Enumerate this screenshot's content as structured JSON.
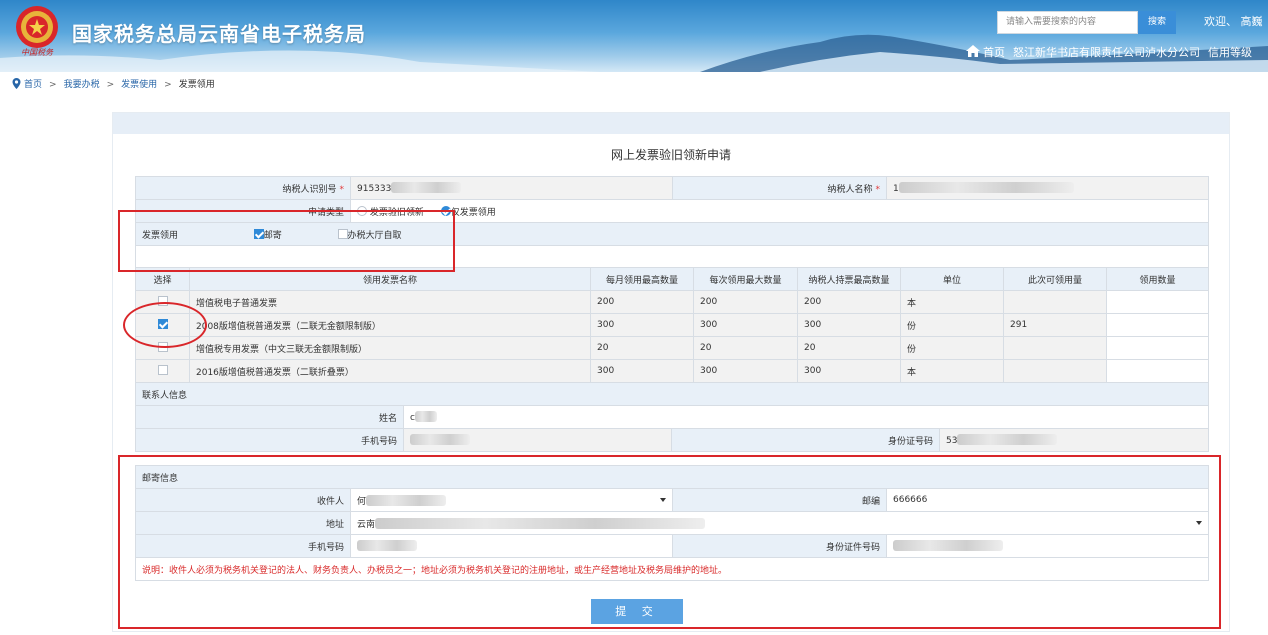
{
  "header": {
    "site_title": "国家税务总局云南省电子税务局",
    "emblem_sub": "中国税务",
    "search_placeholder": "请输入需要搜索的内容",
    "search_button": "搜索",
    "welcome": "欢迎、 高巍",
    "nav_home": "首页",
    "org_name": "怒江新华书店有限责任公司泸水分公司",
    "credit_label": "信用等级"
  },
  "breadcrumb": [
    "首页",
    "我要办税",
    "发票使用",
    "发票领用"
  ],
  "form": {
    "title": "网上发票验旧领新申请",
    "taxpayer_id_label": "纳税人识别号",
    "taxpayer_id_value": "915333",
    "taxpayer_name_label": "纳税人名称",
    "taxpayer_name_value": "1",
    "apply_type_label": "申请类型",
    "apply_type_options": [
      "发票验旧领新",
      "仅发票领用"
    ],
    "receive_label": "发票领用",
    "receive_options": [
      "邮寄",
      "办税大厅自取"
    ],
    "table_headers": [
      "选择",
      "领用发票名称",
      "每月领用最高数量",
      "每次领用最大数量",
      "纳税人持票最高数量",
      "单位",
      "此次可领用量",
      "领用数量"
    ],
    "invoices": [
      {
        "name": "增值税电子普通发票",
        "monthly_max": "200",
        "per_max": "200",
        "hold_max": "200",
        "unit": "本",
        "available": "",
        "qty": "",
        "checked": false
      },
      {
        "name": "2008版增值税普通发票（二联无金额限制版）",
        "monthly_max": "300",
        "per_max": "300",
        "hold_max": "300",
        "unit": "份",
        "available": "291",
        "qty": "",
        "checked": true
      },
      {
        "name": "增值税专用发票（中文三联无金额限制版）",
        "monthly_max": "20",
        "per_max": "20",
        "hold_max": "20",
        "unit": "份",
        "available": "",
        "qty": "",
        "checked": false
      },
      {
        "name": "2016版增值税普通发票（二联折叠票）",
        "monthly_max": "300",
        "per_max": "300",
        "hold_max": "300",
        "unit": "本",
        "available": "",
        "qty": "",
        "checked": false
      }
    ],
    "contact_section": "联系人信息",
    "contact_name_label": "姓名",
    "contact_name_value": "c",
    "phone_label": "手机号码",
    "id_label": "身份证号码",
    "id_value": "53",
    "mail_section": "邮寄信息",
    "recipient_label": "收件人",
    "recipient_value": "何",
    "postcode_label": "邮编",
    "postcode_value": "666666",
    "address_label": "地址",
    "address_value": "云南",
    "mail_phone_label": "手机号码",
    "mail_id_label": "身份证件号码",
    "note": "说明：收件人必须为税务机关登记的法人、财务负责人、办税员之一；地址必须为税务机关登记的注册地址，或生产经营地址及税务局维护的地址。",
    "submit_label": "提 交"
  },
  "colors": {
    "accent": "#2f8ad8",
    "annotation": "#d9262a",
    "label_bg": "#e8f0f8",
    "note_text": "#d92b2b"
  }
}
